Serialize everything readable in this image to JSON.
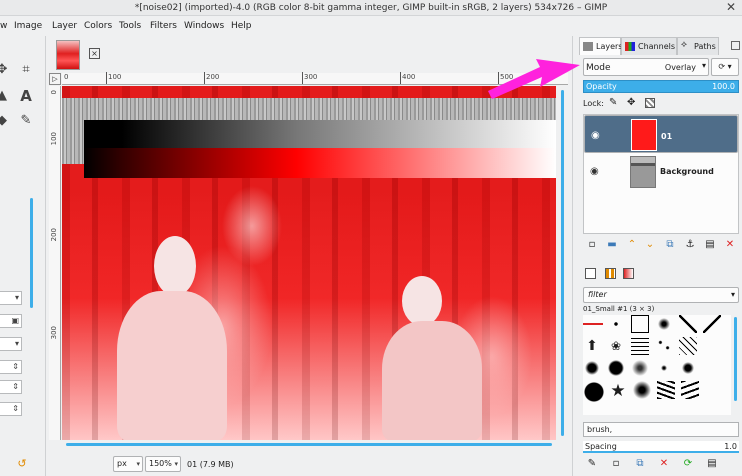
{
  "window": {
    "title": "*[noise02] (imported)-4.0 (RGB color 8-bit gamma integer, GIMP built-in sRGB, 2 layers) 534x726 – GIMP",
    "close": "✕"
  },
  "menu": [
    "w",
    "Image",
    "Layer",
    "Colors",
    "Tools",
    "Filters",
    "Windows",
    "Help"
  ],
  "ruler": {
    "top_labels": [
      "0",
      "100",
      "200",
      "300",
      "400",
      "500"
    ],
    "left_labels": [
      "0",
      "100",
      "200",
      "300"
    ]
  },
  "status": {
    "unit": "px",
    "zoom": "150%",
    "layer_info": "01 (7.9 MB)"
  },
  "dock": {
    "tabs": [
      {
        "label": "Layers",
        "active": true
      },
      {
        "label": "Channels",
        "active": false
      },
      {
        "label": "Paths",
        "active": false
      }
    ],
    "mode_label": "Mode",
    "mode_value": "Overlay",
    "opacity_label": "Opacity",
    "opacity_value": "100.0",
    "lock_label": "Lock:",
    "layers": [
      {
        "name": "01",
        "selected": true,
        "thumb": "red"
      },
      {
        "name": "Background",
        "selected": false,
        "thumb": "photo"
      }
    ],
    "brush_filter": "filter",
    "brush_name": "01_Small #1 (3 × 3)",
    "brush_tag": "brush,",
    "spacing_label": "Spacing",
    "spacing_value": "1.0"
  },
  "colors": {
    "accent": "#3daee9",
    "selected_row": "#4f6d89",
    "annotation_arrow": "#ff22dd"
  }
}
